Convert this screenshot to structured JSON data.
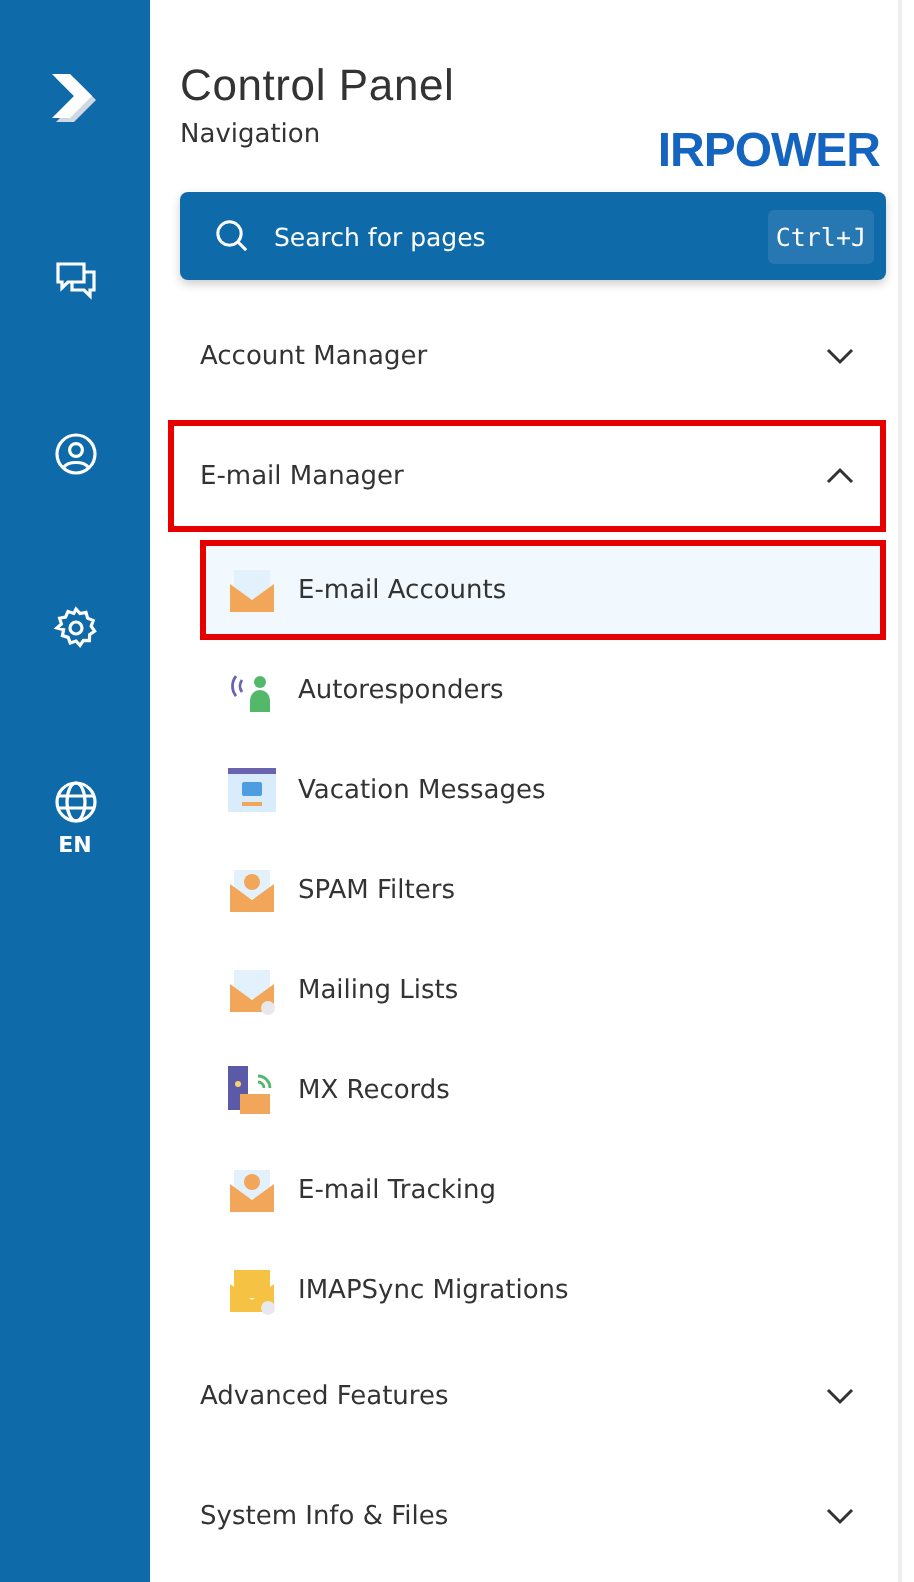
{
  "rail": {
    "language": "EN"
  },
  "header": {
    "title": "Control Panel",
    "subtitle": "Navigation",
    "logo": "IRPOWER"
  },
  "search": {
    "placeholder": "Search for pages",
    "shortcut": "Ctrl+J"
  },
  "sections": [
    {
      "label": "Account Manager",
      "expanded": false,
      "highlighted": false
    },
    {
      "label": "E-mail Manager",
      "expanded": true,
      "highlighted": true,
      "items": [
        {
          "label": "E-mail Accounts",
          "kind": "accounts",
          "selected": true,
          "highlighted": true
        },
        {
          "label": "Autoresponders",
          "kind": "responder",
          "selected": false,
          "highlighted": false
        },
        {
          "label": "Vacation Messages",
          "kind": "vacation",
          "selected": false,
          "highlighted": false
        },
        {
          "label": "SPAM Filters",
          "kind": "spam",
          "selected": false,
          "highlighted": false
        },
        {
          "label": "Mailing Lists",
          "kind": "lists",
          "selected": false,
          "highlighted": false
        },
        {
          "label": "MX Records",
          "kind": "mx",
          "selected": false,
          "highlighted": false
        },
        {
          "label": "E-mail Tracking",
          "kind": "tracking",
          "selected": false,
          "highlighted": false
        },
        {
          "label": "IMAPSync Migrations",
          "kind": "sync",
          "selected": false,
          "highlighted": false
        }
      ]
    },
    {
      "label": "Advanced Features",
      "expanded": false,
      "highlighted": false
    },
    {
      "label": "System Info & Files",
      "expanded": false,
      "highlighted": false
    }
  ]
}
